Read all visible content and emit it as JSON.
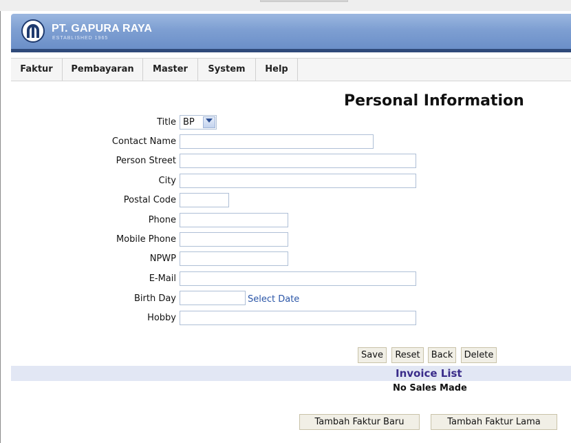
{
  "brand": {
    "name": "PT. GAPURA RAYA",
    "tagline": "ESTABLISHED 1965"
  },
  "menu": [
    {
      "label": "Faktur"
    },
    {
      "label": "Pembayaran"
    },
    {
      "label": "Master"
    },
    {
      "label": "System"
    },
    {
      "label": "Help"
    }
  ],
  "page_title": "Personal Information",
  "form": {
    "title": {
      "label": "Title",
      "value": "BP"
    },
    "contact_name": {
      "label": "Contact Name",
      "value": ""
    },
    "person_street": {
      "label": "Person Street",
      "value": ""
    },
    "city": {
      "label": "City",
      "value": ""
    },
    "postal_code": {
      "label": "Postal Code",
      "value": ""
    },
    "phone": {
      "label": "Phone",
      "value": ""
    },
    "mobile_phone": {
      "label": "Mobile Phone",
      "value": ""
    },
    "npwp": {
      "label": "NPWP",
      "value": ""
    },
    "email": {
      "label": "E-Mail",
      "value": ""
    },
    "birth_day": {
      "label": "Birth Day",
      "value": "",
      "link": "Select Date"
    },
    "hobby": {
      "label": "Hobby",
      "value": ""
    }
  },
  "actions": {
    "save": "Save",
    "reset": "Reset",
    "back": "Back",
    "delete": "Delete"
  },
  "invoice": {
    "title": "Invoice List",
    "empty_text": "No Sales Made",
    "add_new": "Tambah Faktur Baru",
    "add_old": "Tambah Faktur Lama"
  },
  "colors": {
    "banner": "#7e9fd2",
    "banner_bar": "#2f4a7a",
    "link": "#2a55a7",
    "invoice_band": "#e2e7f4",
    "invoice_title": "#3a2c8a"
  }
}
